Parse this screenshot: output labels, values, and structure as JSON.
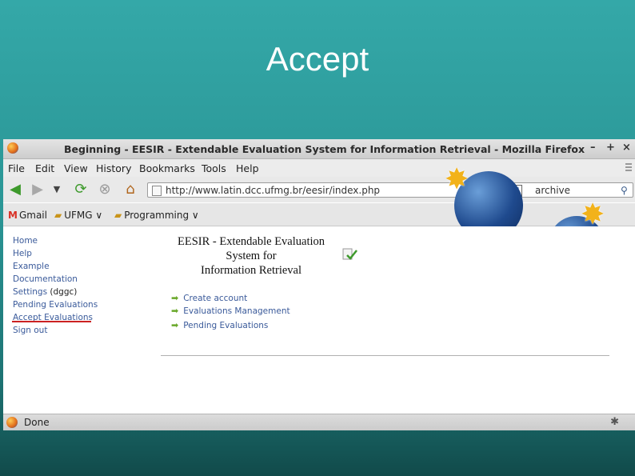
{
  "slide": {
    "title": "Accept"
  },
  "window": {
    "title": "Beginning - EESIR - Extendable Evaluation System for Information Retrieval - Mozilla Firefox",
    "controls": {
      "minimize": "–",
      "maximize": "+",
      "close": "×"
    }
  },
  "menubar": {
    "items": [
      "File",
      "Edit",
      "View",
      "History",
      "Bookmarks",
      "Tools",
      "Help"
    ]
  },
  "navbar": {
    "url": "http://www.latin.dcc.ufmg.br/eesir/index.php",
    "search_value": "archive",
    "search_engine": "G"
  },
  "bookmarks": {
    "items": [
      "Gmail",
      "UFMG ∨",
      "Programming ∨"
    ]
  },
  "sidebar": {
    "links": [
      "Home",
      "Help",
      "Example",
      "Documentation",
      "Settings",
      "Pending Evaluations",
      "Accept Evaluations",
      "Sign out"
    ],
    "settings_user": "(dggc)"
  },
  "main": {
    "title_line1": "EESIR - Extendable Evaluation",
    "title_line2": "System for",
    "title_line3": "Information Retrieval",
    "actions": [
      "Create account",
      "Evaluations Management",
      "Pending Evaluations"
    ]
  },
  "status": {
    "text": "Done"
  },
  "colors": {
    "accent_underline": "#cc2222",
    "link": "#3a5a9a",
    "slide_bg": "#2a9595"
  }
}
